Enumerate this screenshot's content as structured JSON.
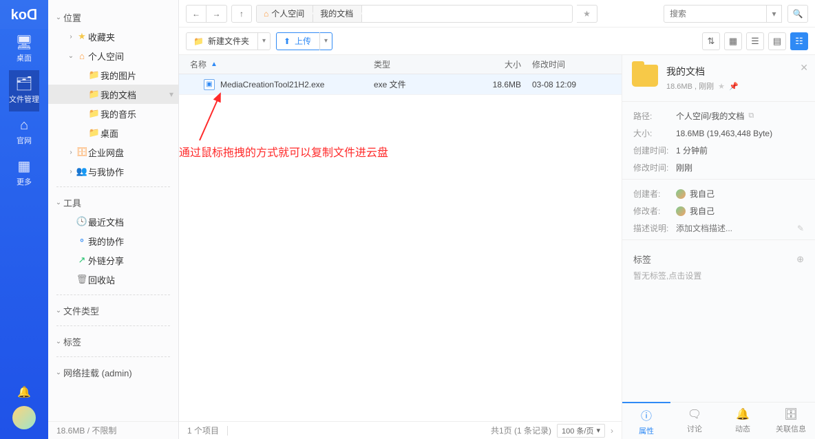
{
  "brand": "koᗡ",
  "icon_bar": [
    {
      "glyph": "🖥",
      "label": "桌面",
      "name": "nav-desktop"
    },
    {
      "glyph": "🗂",
      "label": "文件管理",
      "name": "nav-files",
      "active": true
    },
    {
      "glyph": "⌂",
      "label": "官网",
      "name": "nav-site"
    },
    {
      "glyph": "▦",
      "label": "更多",
      "name": "nav-more"
    }
  ],
  "tree": {
    "sections": [
      {
        "label": "位置",
        "items": [
          {
            "icon": "star",
            "label": "收藏夹",
            "indent": 1,
            "chev": "›"
          },
          {
            "icon": "home",
            "label": "个人空间",
            "indent": 1,
            "chev": "⌄"
          },
          {
            "icon": "fldr",
            "label": "我的图片",
            "indent": 2
          },
          {
            "icon": "fldr",
            "label": "我的文档",
            "indent": 2,
            "sel": true,
            "opt": true
          },
          {
            "icon": "fldr",
            "label": "我的音乐",
            "indent": 2
          },
          {
            "icon": "fldr",
            "label": "桌面",
            "indent": 2
          },
          {
            "icon": "disk",
            "label": "企业网盘",
            "indent": 1,
            "chev": "›"
          },
          {
            "icon": "user",
            "label": "与我协作",
            "indent": 1,
            "chev": "›"
          }
        ]
      },
      {
        "label": "工具",
        "items": [
          {
            "icon": "clock",
            "label": "最近文档",
            "indent": 1
          },
          {
            "icon": "share",
            "label": "我的协作",
            "indent": 1
          },
          {
            "icon": "ext",
            "label": "外链分享",
            "indent": 1
          },
          {
            "icon": "trash",
            "label": "回收站",
            "indent": 1
          }
        ]
      },
      {
        "label": "文件类型",
        "items": []
      },
      {
        "label": "标签",
        "items": []
      },
      {
        "label": "网络挂载 (admin)",
        "items": []
      }
    ],
    "footer": "18.6MB / 不限制"
  },
  "crumb": [
    "个人空间",
    "我的文档"
  ],
  "search_placeholder": "搜索",
  "toolbar": {
    "new_folder": "新建文件夹",
    "upload": "上传"
  },
  "columns": {
    "name": "名称",
    "type": "类型",
    "size": "大小",
    "mtime": "修改时间"
  },
  "rows": [
    {
      "name": "MediaCreationTool21H2.exe",
      "type": "exe 文件",
      "size": "18.6MB",
      "mtime": "03-08 12:09"
    }
  ],
  "overlay_note": "通过鼠标拖拽的方式就可以复制文件进云盘",
  "status": {
    "count": "1 个项目",
    "pages": "共1页 (1 条记录)",
    "per": "100 条/页"
  },
  "detail": {
    "title": "我的文档",
    "sub": "18.6MB , 刚刚",
    "path_label": "路径:",
    "path": "个人空间/我的文档",
    "size_label": "大小:",
    "size": "18.6MB (19,463,448 Byte)",
    "ctime_label": "创建时间:",
    "ctime": "1 分钟前",
    "mtime_label": "修改时间:",
    "mtime": "刚刚",
    "creator_label": "创建者:",
    "creator": "我自己",
    "modifier_label": "修改者:",
    "modifier": "我自己",
    "desc_label": "描述说明:",
    "desc_placeholder": "添加文档描述...",
    "tag_label": "标签",
    "tag_empty": "暂无标签,点击设置",
    "tabs": [
      {
        "g": "ⓘ",
        "label": "属性",
        "active": true,
        "name": "detail-tab-props"
      },
      {
        "g": "🗨",
        "label": "讨论",
        "name": "detail-tab-discuss"
      },
      {
        "g": "🔔",
        "label": "动态",
        "name": "detail-tab-activity"
      },
      {
        "g": "🗄",
        "label": "关联信息",
        "name": "detail-tab-related"
      }
    ]
  }
}
